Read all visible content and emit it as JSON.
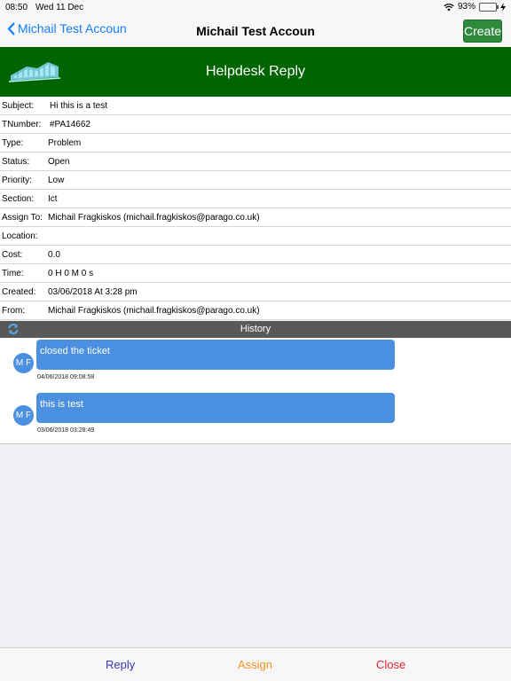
{
  "status_bar": {
    "time": "08:50",
    "date": "Wed 11 Dec",
    "battery": "93%",
    "battery_level": 0.93
  },
  "nav": {
    "back_label": "Michail Test Accoun",
    "title": "Michail Test Accoun",
    "create_label": "Create"
  },
  "banner": {
    "title": "Helpdesk Reply"
  },
  "fields": [
    {
      "label": "Subject:",
      "value": "Hi this is a test"
    },
    {
      "label": "TNumber:",
      "value": "#PA14662"
    },
    {
      "label": "Type:",
      "value": "Problem"
    },
    {
      "label": "Status:",
      "value": "Open"
    },
    {
      "label": "Priority:",
      "value": "Low"
    },
    {
      "label": "Section:",
      "value": "Ict"
    },
    {
      "label": "Assign To:",
      "value": "Michail Fragkiskos (michail.fragkiskos@parago.co.uk)"
    },
    {
      "label": "Location:",
      "value": ""
    },
    {
      "label": "Cost:",
      "value": "0.0"
    },
    {
      "label": "Time:",
      "value": "0 H  0 M 0 s"
    },
    {
      "label": "Created:",
      "value": "03/06/2018  At 3:28 pm"
    },
    {
      "label": "From:",
      "value": "Michail Fragkiskos (michail.fragkiskos@parago.co.uk)"
    }
  ],
  "history": {
    "title": "History",
    "messages": [
      {
        "initials": "M F",
        "text": "closed the ticket",
        "timestamp": "04/06/2018 09:08:58"
      },
      {
        "initials": "M F",
        "text": "this is test",
        "timestamp": "03/06/2018 03:28:49"
      }
    ]
  },
  "footer": {
    "reply_label": "Reply",
    "assign_label": "Assign",
    "close_label": "Close"
  },
  "colors": {
    "banner": "#006400",
    "accent": "#147efb",
    "bubble": "#4a8fe0",
    "reply": "#3a36b4",
    "assign": "#f5901e",
    "close": "#e8252d"
  }
}
